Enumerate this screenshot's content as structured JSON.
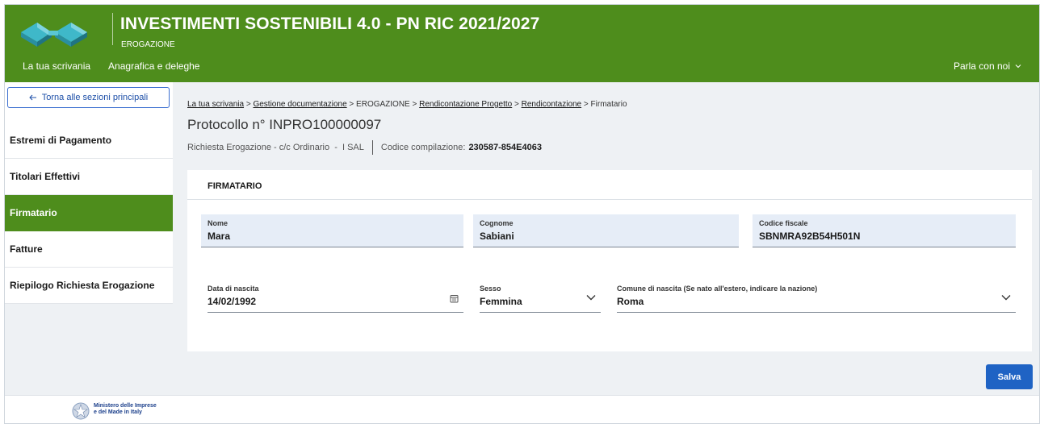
{
  "header": {
    "title": "INVESTIMENTI SOSTENIBILI 4.0 - PN RIC 2021/2027",
    "subtitle": "EROGAZIONE",
    "nav": [
      "La tua scrivania",
      "Anagrafica e deleghe"
    ],
    "contact": "Parla con noi"
  },
  "sidebar": {
    "back_label": "Torna alle sezioni principali",
    "items": [
      {
        "label": "Estremi di Pagamento"
      },
      {
        "label": "Titolari Effettivi"
      },
      {
        "label": "Firmatario"
      },
      {
        "label": "Fatture"
      },
      {
        "label": "Riepilogo Richiesta Erogazione"
      }
    ]
  },
  "breadcrumb": {
    "items": [
      "La tua scrivania",
      "Gestione documentazione",
      "EROGAZIONE",
      "Rendicontazione Progetto",
      "Rendicontazione",
      "Firmatario"
    ],
    "sep": ">"
  },
  "protocol": "Protocollo n° INPRO100000097",
  "meta": {
    "request": "Richiesta Erogazione - c/c Ordinario  -  I SAL",
    "code_label": "Codice compilazione:",
    "code_value": "230587-854E4063"
  },
  "section": {
    "title": "FIRMATARIO",
    "fields": {
      "nome": {
        "label": "Nome",
        "value": "Mara"
      },
      "cognome": {
        "label": "Cognome",
        "value": "Sabiani"
      },
      "codice_fiscale": {
        "label": "Codice fiscale",
        "value": "SBNMRA92B54H501N"
      },
      "data_nascita": {
        "label": "Data di nascita",
        "value": "14/02/1992"
      },
      "sesso": {
        "label": "Sesso",
        "value": "Femmina"
      },
      "comune": {
        "label": "Comune di nascita (Se nato all'estero, indicare la nazione)",
        "value": "Roma"
      }
    }
  },
  "actions": {
    "save": "Salva"
  },
  "footer": {
    "ministry_line1": "Ministero delle Imprese",
    "ministry_line2": "e del Made in Italy"
  },
  "colors": {
    "brand_green": "#4e8d1c",
    "primary_blue": "#1f63c4",
    "field_fill": "#e6edf7"
  },
  "icons": [
    "logo-mark",
    "arrow-left-icon",
    "chevron-down-icon",
    "calendar-icon",
    "emblem-icon"
  ]
}
